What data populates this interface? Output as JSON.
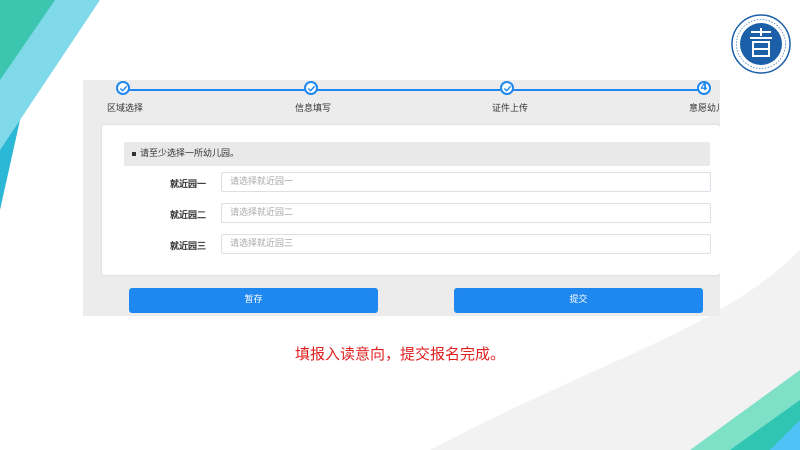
{
  "progress": {
    "steps": [
      {
        "label": "区域选择",
        "state": "done"
      },
      {
        "label": "信息填写",
        "state": "done"
      },
      {
        "label": "证件上传",
        "state": "done"
      },
      {
        "label": "意愿幼儿",
        "number": "4",
        "state": "current"
      }
    ]
  },
  "form": {
    "notice": "请至少选择一所幼儿园。",
    "rows": [
      {
        "label": "就近园一",
        "placeholder": "请选择就近园一"
      },
      {
        "label": "就近园二",
        "placeholder": "请选择就近园二"
      },
      {
        "label": "就近园三",
        "placeholder": "请选择就近园三"
      }
    ]
  },
  "buttons": {
    "save": "暂存",
    "submit": "提交"
  },
  "caption": "填报入读意向，提交报名完成。",
  "colors": {
    "accent": "#1e88f0",
    "caption": "#e02020",
    "teal": "#3cc6b0",
    "sky": "#4fc3f7"
  }
}
